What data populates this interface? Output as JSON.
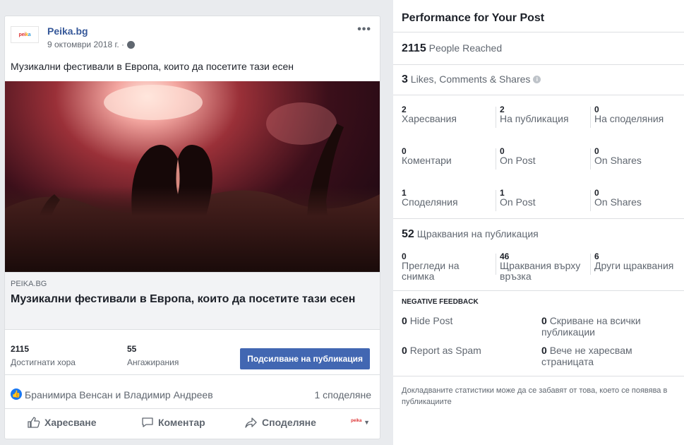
{
  "post": {
    "page_name": "Peika.bg",
    "date": "9 октомври 2018 г. ·",
    "text": "Музикални фестивали в Европа, които да посетите тази есен",
    "link": {
      "domain": "PEIKA.BG",
      "title": "Музикални фестивали в Европа, които да посетите тази есен"
    },
    "stats": {
      "reached_value": "2115",
      "reached_label": "Достигнати хора",
      "engagements_value": "55",
      "engagements_label": "Ангажирания",
      "boost_label": "Подсилване на публикация"
    },
    "reactions": {
      "names": "Бранимира Венсан и Владимир Андреев",
      "shares": "1 споделяне"
    },
    "actions": {
      "like": "Харесване",
      "comment": "Коментар",
      "share": "Споделяне"
    },
    "icons": [
      "globe-icon",
      "more-icon",
      "like-icon",
      "thumb-icon",
      "comment-icon",
      "share-icon",
      "caret-icon"
    ]
  },
  "panel": {
    "title": "Performance for Your Post",
    "reach": {
      "value": "2115",
      "label": "People Reached"
    },
    "engagement": {
      "value": "3",
      "label": "Likes, Comments & Shares"
    },
    "rows": [
      {
        "total": {
          "n": "2",
          "label": "Харесвания"
        },
        "on_post": {
          "n": "2",
          "label": "На публикация"
        },
        "on_shares": {
          "n": "0",
          "label": "На споделяния"
        }
      },
      {
        "total": {
          "n": "0",
          "label": "Коментари"
        },
        "on_post": {
          "n": "0",
          "label": "On Post"
        },
        "on_shares": {
          "n": "0",
          "label": "On Shares"
        }
      },
      {
        "total": {
          "n": "1",
          "label": "Споделяния"
        },
        "on_post": {
          "n": "1",
          "label": "On Post"
        },
        "on_shares": {
          "n": "0",
          "label": "On Shares"
        }
      }
    ],
    "clicks": {
      "value": "52",
      "label": "Щраквания на публикация",
      "photo_views": {
        "n": "0",
        "label": "Прегледи на снимка"
      },
      "link_clicks": {
        "n": "46",
        "label": "Щраквания върху връзка"
      },
      "other_clicks": {
        "n": "6",
        "label": "Други щраквания"
      }
    },
    "negative": {
      "title": "NEGATIVE FEEDBACK",
      "hide_post": {
        "n": "0",
        "label": "Hide Post"
      },
      "hide_all": {
        "n": "0",
        "label": "Скриване на всички публикации"
      },
      "spam": {
        "n": "0",
        "label": "Report as Spam"
      },
      "unlike": {
        "n": "0",
        "label": "Вече не харесвам страницата"
      }
    },
    "disclaimer": "Докладваните статистики може да се забавят от това, което се появява в публикациите"
  }
}
